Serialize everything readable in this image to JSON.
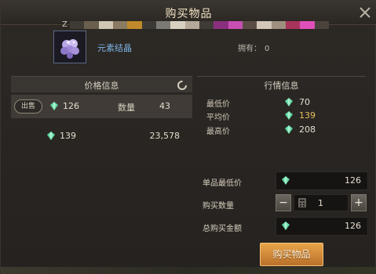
{
  "window": {
    "title": "购买物品",
    "header_prefix": "Z",
    "mosaic_colors": [
      "#3e3a34",
      "#6a5f4d",
      "#cfc6b3",
      "#8a7b62",
      "#c08a2b",
      "#3b3a36",
      "#7c7a74",
      "#d8d0c0",
      "#b7a99a",
      "#3f3c37",
      "#8a2f7d",
      "#c84fb2",
      "#5b4d44",
      "#d3c7ba",
      "#9e8f7f",
      "#a7345c",
      "#e14fb9",
      "#4a433c"
    ]
  },
  "item": {
    "name": "元素结晶",
    "own_label": "拥有：",
    "own_count": "0"
  },
  "price_panel": {
    "header": "价格信息",
    "sell_button": "出售",
    "row1": {
      "price": "126",
      "qty_label": "数量",
      "qty": "43"
    },
    "row2": {
      "price": "139",
      "qty": "23,578"
    }
  },
  "market_panel": {
    "header": "行情信息",
    "min_label": "最低价",
    "min_value": "70",
    "avg_label": "平均价",
    "avg_value": "139",
    "max_label": "最高价",
    "max_value": "208"
  },
  "purchase": {
    "unit_price_label": "单品最低价",
    "unit_price": "126",
    "qty_label": "购买数量",
    "qty_value": "1",
    "minus": "−",
    "plus": "+",
    "total_label": "总购买金额",
    "total": "126",
    "buy_button": "购买物品"
  },
  "colors": {
    "item_name": "#7eb4e6",
    "avg_value": "#e6c15c",
    "gem": "#5fd7a0",
    "button": "#d9903d"
  }
}
